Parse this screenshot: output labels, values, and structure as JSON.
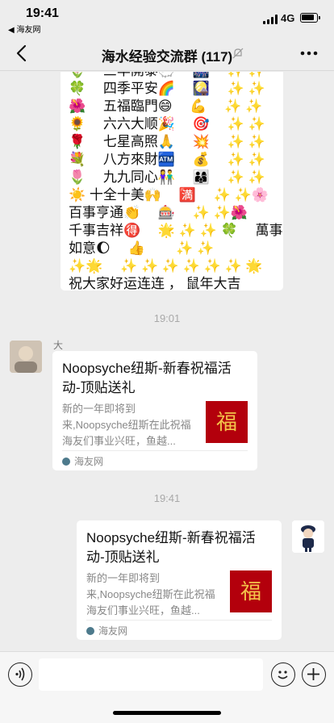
{
  "status": {
    "time": "19:41",
    "back_app": "◀ 海友网",
    "network": "4G"
  },
  "nav": {
    "title": "海水经验交流群 (117)"
  },
  "greeting": {
    "rows": [
      "🌷　  三羊開泰🐑　 🎆　 ✨ ✨",
      "🍀　  四季平安🌈　 🎑　 ✨ ✨",
      "🌺　  五福臨門😄　 💪　 ✨ ✨",
      "🌻　  六六大顺🎉　 🎯　 ✨ ✨",
      "🌹　  七星高照🙏　 💥　 ✨ ✨",
      "💐　  八方來財🏧　 💰　 ✨ ✨",
      "🌷　  九九同心👫　 👨‍👩‍👦　 ✨ ✨",
      "☀️  十全十美🙌　 🈵　 ✨ ✨🌸",
      " 百事亨通👏　 🎰　 ✨ ✨🌺",
      "千事吉祥🉐　 🌟 ✨ ✨ 🍀　  萬事",
      "如意🌔　  👍　　 ✨ ✨",
      " ✨🌟　 ✨ ✨ ✨ ✨ ✨ ✨ 🌟",
      "  祝大家好运连连 ， 鼠年大吉"
    ]
  },
  "time_tags": [
    "19:01",
    "19:41"
  ],
  "message_left": {
    "sender": "大",
    "title": "Noopsyche纽斯-新春祝福活动-顶贴送礼",
    "desc": "新的一年即将到来,Noopsyche纽斯在此祝福海友们事业兴旺，鱼越...",
    "source": "海友网",
    "thumb_char": "福"
  },
  "message_right": {
    "title": "Noopsyche纽斯-新春祝福活动-顶贴送礼",
    "desc": "新的一年即将到来,Noopsyche纽斯在此祝福海友们事业兴旺，鱼越...",
    "source": "海友网",
    "thumb_char": "福"
  },
  "colors": {
    "background": "#ededed",
    "thumb": "#b3000c",
    "bubble": "#ffffff"
  }
}
